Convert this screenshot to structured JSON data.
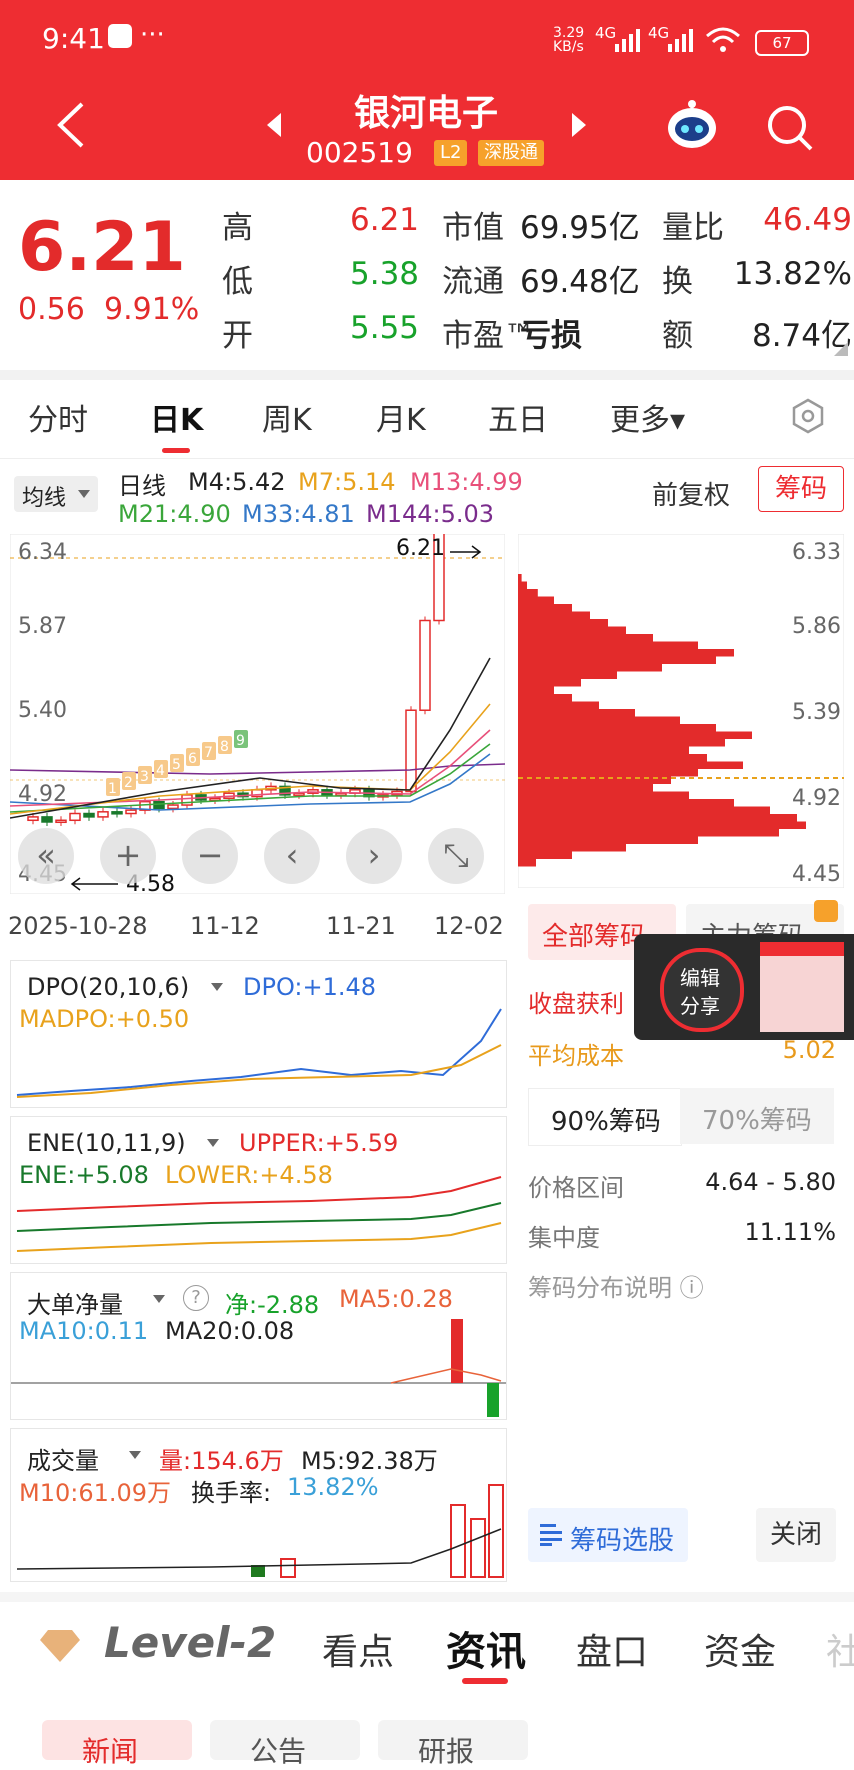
{
  "status_bar": {
    "time": "9:41",
    "dots": "···",
    "net_speed": "3.29",
    "net_unit": "KB/s",
    "sig1": "4G",
    "sig2": "4G",
    "battery": "67"
  },
  "header": {
    "title": "银河电子",
    "code": "002519",
    "tag_l2": "L2",
    "tag_connect": "深股通"
  },
  "quote": {
    "price": "6.21",
    "change": "0.56",
    "change_pct": "9.91%",
    "rows": [
      {
        "l1": "高",
        "v1": "6.21",
        "l2": "市值",
        "v2": "69.95亿",
        "l3": "量比",
        "v3": "46.49"
      },
      {
        "l1": "低",
        "v1": "5.38",
        "l2": "流通",
        "v2": "69.48亿",
        "l3": "换",
        "v3": "13.82%"
      },
      {
        "l1": "开",
        "v1": "5.55",
        "l2": "市盈™",
        "v2": "亏损",
        "l3": "额",
        "v3": "8.74亿"
      }
    ]
  },
  "period_tabs": [
    "分时",
    "日K",
    "周K",
    "月K",
    "五日",
    "更多▾"
  ],
  "ma_bar": {
    "selector": "均线",
    "daily": "日线",
    "m4": "M4:5.42",
    "m7": "M7:5.14",
    "m13": "M13:4.99",
    "m21": "M21:4.90",
    "m33": "M33:4.81",
    "m144": "M144:5.03",
    "adjust": "前复权",
    "chips_btn": "筹码"
  },
  "colors": {
    "m4": "#222222",
    "m7": "#e8a21c",
    "m13": "#e8507a",
    "m21": "#3aa63a",
    "m33": "#3478c8",
    "m144": "#7a2c8c",
    "up": "#e32b2b",
    "down": "#18792b"
  },
  "kline": {
    "y_ticks": [
      "6.34",
      "5.87",
      "5.40",
      "4.92",
      "4.45"
    ],
    "high_marker": "6.21",
    "low_marker": "4.58",
    "seq_labels": [
      "1",
      "2",
      "3",
      "4",
      "5",
      "6",
      "7",
      "8",
      "9"
    ],
    "x_dates": [
      "2025-10-28",
      "11-12",
      "11-21",
      "12-02"
    ]
  },
  "chart_data": {
    "type": "candlestick",
    "x": [
      "2025-10-28",
      "11-12",
      "11-21",
      "12-02"
    ],
    "ylim": [
      4.45,
      6.34
    ],
    "last_close": 6.21,
    "period_low": 4.58,
    "high": 6.21,
    "low": 5.38,
    "open": 5.55
  },
  "chips": {
    "y_ticks": [
      "6.33",
      "5.86",
      "5.39",
      "4.92",
      "4.45"
    ],
    "tab_all": "全部筹码",
    "tab_main": "主力筹码",
    "profit_label": "收盘获利",
    "avg_cost_label": "平均成本",
    "avg_cost_value": "5.02",
    "pct90": "90%筹码",
    "pct70": "70%筹码",
    "range_label": "价格区间",
    "range_value": "4.64 - 5.80",
    "conc_label": "集中度",
    "conc_value": "11.11%",
    "explain": "筹码分布说明 ⓘ",
    "select_btn": "筹码选股",
    "close_btn": "关闭"
  },
  "share_float": {
    "line1": "编辑",
    "line2": "分享"
  },
  "dpo": {
    "name": "DPO(20,10,6)",
    "dpo": "DPO:+1.48",
    "madpo": "MADPO:+0.50"
  },
  "ene": {
    "name": "ENE(10,11,9)",
    "upper": "UPPER:+5.59",
    "ene": "ENE:+5.08",
    "lower": "LOWER:+4.58"
  },
  "bigorder": {
    "name": "大单净量",
    "net": "净:-2.88",
    "ma5": "MA5:0.28",
    "ma10": "MA10:0.11",
    "ma20": "MA20:0.08"
  },
  "volume": {
    "name": "成交量",
    "vol": "量:154.6万",
    "m5": "M5:92.38万",
    "m10": "M10:61.09万",
    "turnover_label": "换手率:",
    "turnover_value": "13.82%"
  },
  "bottom_tabs": {
    "brand": "Level-2",
    "items": [
      "看点",
      "资讯",
      "盘口",
      "资金",
      "社"
    ]
  },
  "sub_tabs": [
    "新闻",
    "公告",
    "研报"
  ]
}
